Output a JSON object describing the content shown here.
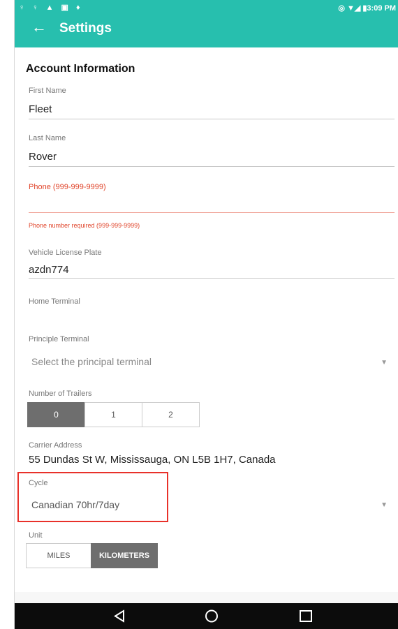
{
  "status_bar": {
    "left_icons": "♀ ♀ ▲ ▣ ♦",
    "right": "◎ ▼◢ ▮3:09 PM"
  },
  "app_bar": {
    "back_icon": "arrow-back",
    "title": "Settings"
  },
  "form": {
    "section_title": "Account Information",
    "first_name": {
      "label": "First Name",
      "value": "Fleet"
    },
    "last_name": {
      "label": "Last Name",
      "value": "Rover"
    },
    "phone": {
      "label": "Phone (999-999-9999)",
      "value": "",
      "error": "Phone number required (999-999-9999)"
    },
    "license_plate": {
      "label": "Vehicle License Plate",
      "value": "azdn774"
    },
    "home_terminal": {
      "label": "Home Terminal"
    },
    "principle_terminal": {
      "label": "Principle Terminal",
      "placeholder": "Select the principal terminal"
    },
    "trailers": {
      "label": "Number of Trailers",
      "options": [
        "0",
        "1",
        "2"
      ],
      "selected": "0"
    },
    "carrier_address": {
      "label": "Carrier Address",
      "value": "55 Dundas St W, Mississauga, ON L5B 1H7, Canada"
    },
    "cycle": {
      "label": "Cycle",
      "value": "Canadian 70hr/7day"
    },
    "unit": {
      "label": "Unit",
      "options": [
        "MILES",
        "KILOMETERS"
      ],
      "selected": "KILOMETERS"
    }
  },
  "nav_bar": {
    "back": "◁",
    "home": "○",
    "recents": "□"
  },
  "colors": {
    "primary": "#27bfae",
    "error": "#e0442a",
    "highlight": "#e8312a",
    "segment_active": "#6e6e6e"
  }
}
